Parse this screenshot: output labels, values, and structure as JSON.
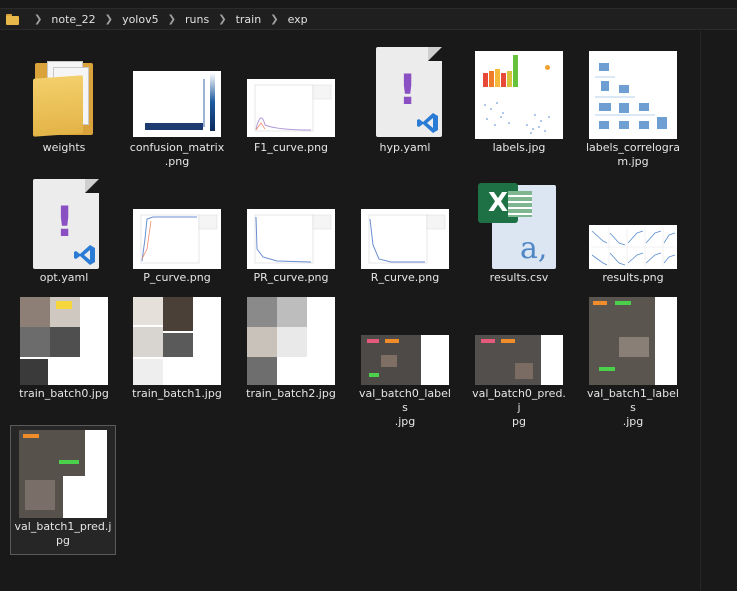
{
  "breadcrumb": [
    "note_22",
    "yolov5",
    "runs",
    "train",
    "exp"
  ],
  "files": [
    {
      "name": "weights",
      "icon": "folder-icon"
    },
    {
      "name": "confusion_matrix.png",
      "icon": "image-thumbnail"
    },
    {
      "name": "F1_curve.png",
      "icon": "image-thumbnail"
    },
    {
      "name": "hyp.yaml",
      "icon": "yaml-file-icon"
    },
    {
      "name": "labels.jpg",
      "icon": "image-thumbnail"
    },
    {
      "name": "labels_correlogram.jpg",
      "icon": "image-thumbnail"
    },
    {
      "name": "opt.yaml",
      "icon": "yaml-file-icon"
    },
    {
      "name": "P_curve.png",
      "icon": "image-thumbnail"
    },
    {
      "name": "PR_curve.png",
      "icon": "image-thumbnail"
    },
    {
      "name": "R_curve.png",
      "icon": "image-thumbnail"
    },
    {
      "name": "results.csv",
      "icon": "excel-csv-icon"
    },
    {
      "name": "results.png",
      "icon": "image-thumbnail"
    },
    {
      "name": "train_batch0.jpg",
      "icon": "image-thumbnail"
    },
    {
      "name": "train_batch1.jpg",
      "icon": "image-thumbnail"
    },
    {
      "name": "train_batch2.jpg",
      "icon": "image-thumbnail"
    },
    {
      "name": "val_batch0_labels.jpg",
      "icon": "image-thumbnail"
    },
    {
      "name": "val_batch0_pred.jpg",
      "icon": "image-thumbnail"
    },
    {
      "name": "val_batch1_labels.jpg",
      "icon": "image-thumbnail"
    },
    {
      "name": "val_batch1_pred.jpg",
      "icon": "image-thumbnail"
    }
  ],
  "labels": {
    "f0": "weights",
    "f1a": "confusion_matrix",
    "f1b": ".png",
    "f2": "F1_curve.png",
    "f3": "hyp.yaml",
    "f4": "labels.jpg",
    "f5a": "labels_correlogra",
    "f5b": "m.jpg",
    "f6": "opt.yaml",
    "f7": "P_curve.png",
    "f8": "PR_curve.png",
    "f9": "R_curve.png",
    "f10": "results.csv",
    "f11": "results.png",
    "f12": "train_batch0.jpg",
    "f13": "train_batch1.jpg",
    "f14": "train_batch2.jpg",
    "f15a": "val_batch0_labels",
    "f15b": ".jpg",
    "f16a": "val_batch0_pred.j",
    "f16b": "pg",
    "f17a": "val_batch1_labels",
    "f17b": ".jpg",
    "f18a": "val_batch1_pred.j",
    "f18b": "pg"
  },
  "excel_letter": "a,",
  "colors": {
    "accent_yaml": "#8a4fc2",
    "vscode_blue": "#2a7bd5",
    "excel_green": "#1e7145",
    "folder": "#e8b84a"
  }
}
